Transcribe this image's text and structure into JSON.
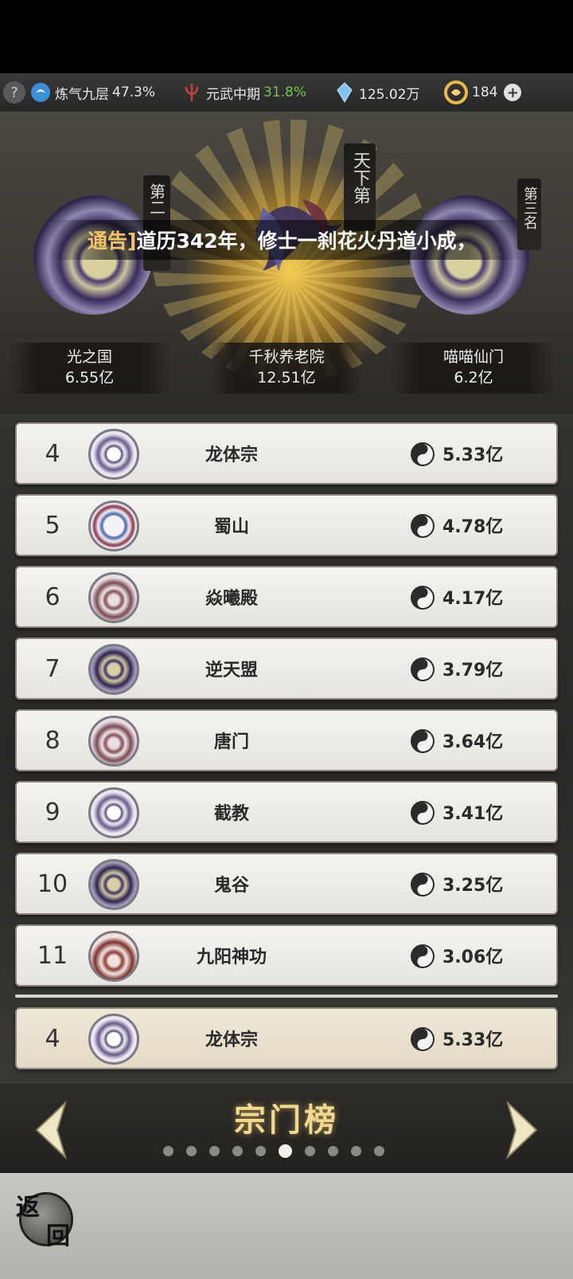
{
  "status_bar": {
    "help_icon": "question-mark",
    "cultivation_label": "炼气九层",
    "cultivation_pct": "47.3%",
    "martial_label": "元武中期",
    "martial_pct": "31.8%",
    "spirit_stones": "125.02万",
    "currency_count": "184",
    "plus_label": "+"
  },
  "hero": {
    "announcement_tag": "通告]",
    "announcement_text": "道历342年，修士一刹花火丹道小成，",
    "pillar_left": "第二",
    "pillar_center": "天下第",
    "pillar_right": "第三名",
    "podium": [
      {
        "name": "光之国",
        "score": "6.55亿"
      },
      {
        "name": "千秋养老院",
        "score": "12.51亿"
      },
      {
        "name": "喵喵仙门",
        "score": "6.2亿"
      }
    ]
  },
  "ranking": {
    "rows": [
      {
        "rank": "4",
        "name": "龙体宗",
        "score": "5.33亿",
        "emblem": "dragon-crest"
      },
      {
        "rank": "5",
        "name": "蜀山",
        "score": "4.78亿",
        "emblem": "koi-crest"
      },
      {
        "rank": "6",
        "name": "焱曦殿",
        "score": "4.17亿",
        "emblem": "cloud-crest"
      },
      {
        "rank": "7",
        "name": "逆天盟",
        "score": "3.79亿",
        "emblem": "rose-crest"
      },
      {
        "rank": "8",
        "name": "唐门",
        "score": "3.64亿",
        "emblem": "cloud-crest"
      },
      {
        "rank": "9",
        "name": "截教",
        "score": "3.41亿",
        "emblem": "dragon-crest"
      },
      {
        "rank": "10",
        "name": "鬼谷",
        "score": "3.25亿",
        "emblem": "rose-crest"
      },
      {
        "rank": "11",
        "name": "九阳神功",
        "score": "3.06亿",
        "emblem": "flame-crest"
      }
    ],
    "my_row": {
      "rank": "4",
      "name": "龙体宗",
      "score": "5.33亿",
      "emblem": "dragon-crest"
    }
  },
  "footer": {
    "board_title": "宗门榜",
    "page_count": 10,
    "active_page": 6,
    "back_char_1": "返",
    "back_char_2": "回"
  },
  "colors": {
    "accent_gold": "#f0d890",
    "green_pct": "#76c24a",
    "row_bg": "#f0efeb",
    "my_row_bg": "#ebe3d0"
  }
}
